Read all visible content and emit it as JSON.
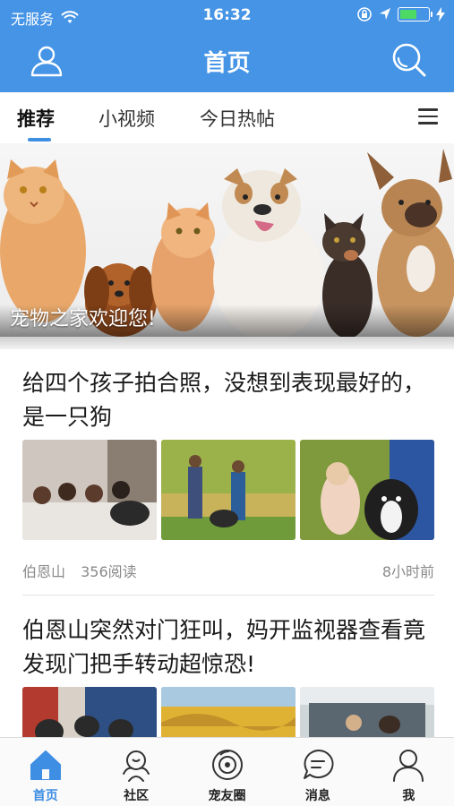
{
  "status_bar": {
    "carrier": "无服务",
    "time": "16:32",
    "battery_level": 0.6,
    "icons": [
      "wifi-icon",
      "rotation-lock-icon",
      "location-icon",
      "battery-icon",
      "charging-icon"
    ]
  },
  "nav": {
    "title": "首页",
    "left_icon": "user-icon",
    "right_icon": "search-icon"
  },
  "tabs": {
    "items": [
      {
        "label": "推荐",
        "active": true
      },
      {
        "label": "小视频",
        "active": false
      },
      {
        "label": "今日热帖",
        "active": false
      }
    ],
    "menu_icon": "hamburger-menu-icon"
  },
  "banner": {
    "caption": "宠物之家欢迎您!"
  },
  "feed": [
    {
      "title": "给四个孩子拍合照，没想到表现最好的，是一只狗",
      "author": "伯恩山",
      "reads": "356阅读",
      "time": "8小时前"
    },
    {
      "title": "伯恩山突然对门狂叫，妈开监视器查看竟发现门把手转动超惊恐!"
    }
  ],
  "tabbar": {
    "items": [
      {
        "label": "首页",
        "icon": "home-icon",
        "active": true
      },
      {
        "label": "社区",
        "icon": "community-icon",
        "active": false
      },
      {
        "label": "宠友圈",
        "icon": "pet-circle-icon",
        "active": false
      },
      {
        "label": "消息",
        "icon": "message-icon",
        "active": false
      },
      {
        "label": "我",
        "icon": "profile-icon",
        "active": false
      }
    ]
  },
  "colors": {
    "primary": "#4594e6",
    "accent": "#3e8ee3",
    "battery_fill": "#4cd964"
  }
}
